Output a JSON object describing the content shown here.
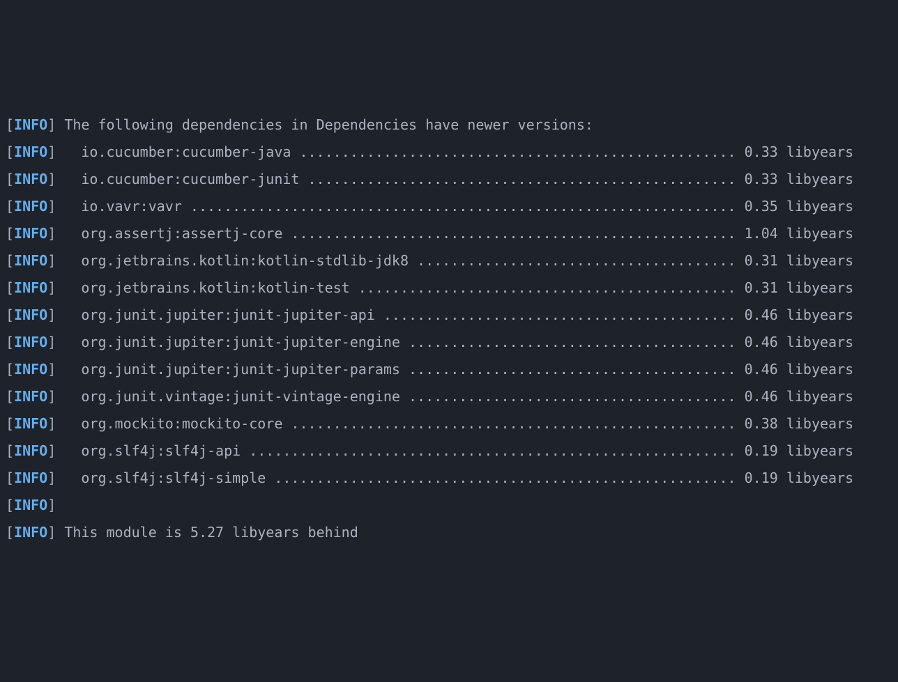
{
  "log_level": "INFO",
  "header": "The following dependencies in Dependencies have newer versions:",
  "unit": "libyears",
  "dependencies": [
    {
      "name": "io.cucumber:cucumber-java",
      "value": "0.33"
    },
    {
      "name": "io.cucumber:cucumber-junit",
      "value": "0.33"
    },
    {
      "name": "io.vavr:vavr",
      "value": "0.35"
    },
    {
      "name": "org.assertj:assertj-core",
      "value": "1.04"
    },
    {
      "name": "org.jetbrains.kotlin:kotlin-stdlib-jdk8",
      "value": "0.31"
    },
    {
      "name": "org.jetbrains.kotlin:kotlin-test",
      "value": "0.31"
    },
    {
      "name": "org.junit.jupiter:junit-jupiter-api",
      "value": "0.46"
    },
    {
      "name": "org.junit.jupiter:junit-jupiter-engine",
      "value": "0.46"
    },
    {
      "name": "org.junit.jupiter:junit-jupiter-params",
      "value": "0.46"
    },
    {
      "name": "org.junit.vintage:junit-vintage-engine",
      "value": "0.46"
    },
    {
      "name": "org.mockito:mockito-core",
      "value": "0.38"
    },
    {
      "name": "org.slf4j:slf4j-api",
      "value": "0.19"
    },
    {
      "name": "org.slf4j:slf4j-simple",
      "value": "0.19"
    }
  ],
  "summary": "This module is 5.27 libyears behind"
}
